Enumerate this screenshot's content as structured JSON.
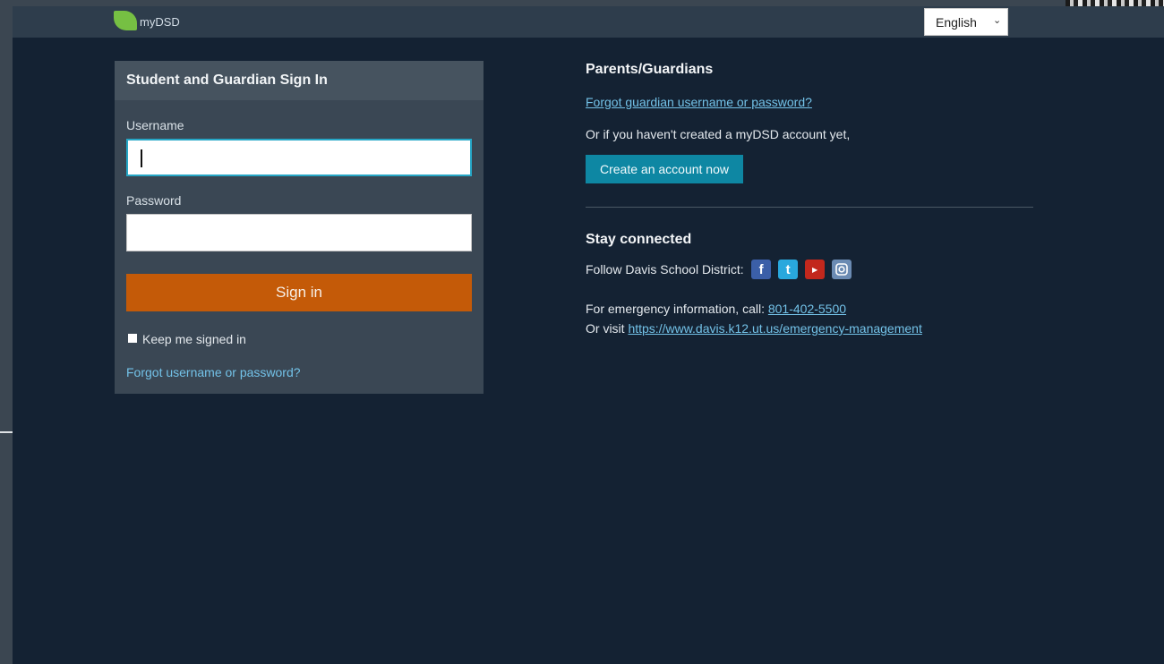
{
  "header": {
    "logo_text": "myDSD",
    "language": {
      "selected": "English"
    }
  },
  "signin": {
    "title": "Student and Guardian Sign In",
    "username_label": "Username",
    "username_value": "",
    "password_label": "Password",
    "password_value": "",
    "signin_button": "Sign in",
    "keep_signed_in": "Keep me signed in",
    "forgot_link": "Forgot username or password?"
  },
  "parents": {
    "title": "Parents/Guardians",
    "forgot_link": "Forgot guardian username or password?",
    "no_account_text": "Or if you haven't created a myDSD account yet,",
    "create_button": "Create an account now"
  },
  "stay_connected": {
    "title": "Stay connected",
    "follow_text": "Follow Davis School District:",
    "social_icons": [
      "facebook-icon",
      "twitter-icon",
      "youtube-icon",
      "instagram-icon"
    ],
    "emergency_text": "For emergency information, call:",
    "emergency_phone": "801-402-5500",
    "visit_text": "Or visit",
    "visit_link": "https://www.davis.k12.ut.us/emergency-management"
  },
  "colors": {
    "page_bg": "#142233",
    "topbar_bg": "#2e3d4c",
    "card_bg": "#3a4754",
    "signin_button": "#c45a08",
    "create_button": "#0e87a3",
    "link": "#73c2e8",
    "logo_green": "#76c043"
  }
}
